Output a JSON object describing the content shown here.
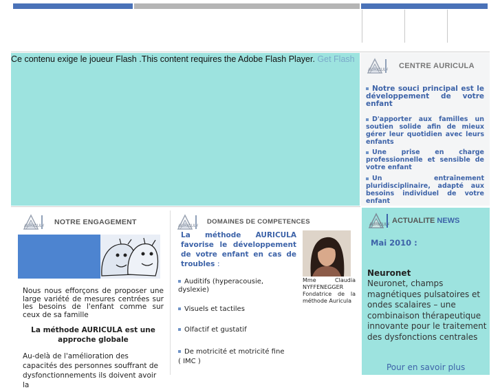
{
  "flash": {
    "message": "Ce contenu exige le joueur Flash .This content requires the Adobe Flash Player.",
    "link": "Get Flash"
  },
  "centre": {
    "title": "CENTRE AURICULA",
    "items": [
      "Notre souci principal est le développement de votre enfant",
      "D'apporter aux familles un soutien solide afin de mieux gérer leur quotidien avec leurs enfants",
      "Une prise en charge professionnelle et sensible de votre enfant",
      "Un entraînement pluridisciplinaire, adapté aux besoins individuel de votre enfant"
    ]
  },
  "engagement": {
    "title": "NOTRE ENGAGEMENT",
    "paragraph": "Nous nous efforçons de proposer une large variété de mesures centrées sur les besoins de l'enfant comme sur ceux de sa famille",
    "heading": "La méthode AURICULA est une approche globale",
    "paragraph2": "Au-delà de l'amélioration des capacités des personnes souffrant de dysfonctionnements ils doivent avoir la"
  },
  "domaines": {
    "title": "DOMAINES DE COMPETENCES",
    "intro": "La méthode AURICULA favorise le développement de votre enfant en cas de troubles",
    "intro_suffix": ":",
    "items": [
      "Auditifs (hyperacousie, dyslexie)",
      "Visuels et tactiles",
      "Olfactif et gustatif",
      "De motricité et motricité fine ( IMC )"
    ],
    "caption": "Mme Claudia NYFFENEGGER Fondatrice de la méthode Auricula"
  },
  "actualite": {
    "title_a": "ACTUALITE",
    "title_b": "NEWS",
    "date": "Mai 2010 :",
    "headline": "Neuronet",
    "body": "Neuronet, champs magnétiques pulsatoires et ondes scalaires – une combinaison thérapeutique innovante pour le traitement des dysfonctions centrales",
    "more": "Pour en savoir plus"
  },
  "colors": {
    "blue": "#4a72b8",
    "teal": "#9de3df",
    "link": "#3d63a8"
  }
}
